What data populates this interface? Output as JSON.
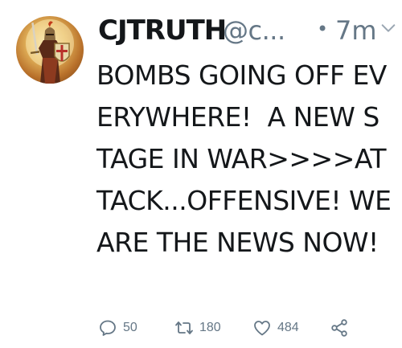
{
  "tweet": {
    "display_name": "CJTRUTH",
    "handle": "@c...",
    "separator": "•",
    "timestamp": "7m",
    "text": "BOMBS GOING OFF EVERYWHERE!  A NEW STAGE IN WAR>>>>ATTACK...OFFENSIVE! WE ARE THE NEWS NOW!",
    "avatar_icon": "knight-avatar",
    "menu_icon": "chevron-down-icon"
  },
  "actions": {
    "reply_count": "50",
    "retweet_count": "180",
    "like_count": "484",
    "reply_icon": "reply-icon",
    "retweet_icon": "retweet-icon",
    "like_icon": "heart-icon",
    "share_icon": "share-icon"
  },
  "colors": {
    "text": "#14171a",
    "secondary": "#657786",
    "background": "#ffffff"
  }
}
